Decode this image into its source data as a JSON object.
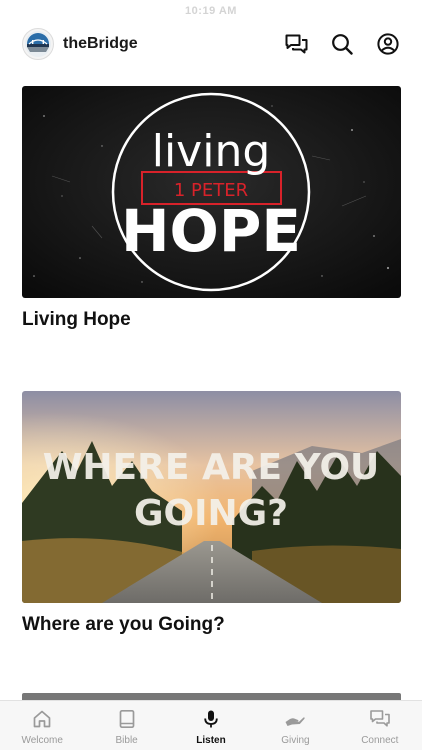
{
  "status_bar": {
    "time": "10:19 AM"
  },
  "header": {
    "app_name": "theBridge"
  },
  "feed": [
    {
      "title": "Living Hope",
      "artwork": {
        "line1": "living",
        "line2": "1 PETER",
        "line3": "HOPE"
      }
    },
    {
      "title": "Where are you Going?",
      "artwork": {
        "line1": "WHERE ARE YOU",
        "line2": "GOING?"
      }
    }
  ],
  "tabs": [
    {
      "label": "Welcome",
      "icon": "home-icon",
      "active": false
    },
    {
      "label": "Bible",
      "icon": "book-icon",
      "active": false
    },
    {
      "label": "Listen",
      "icon": "microphone-icon",
      "active": true
    },
    {
      "label": "Giving",
      "icon": "giving-hand-icon",
      "active": false
    },
    {
      "label": "Connect",
      "icon": "chat-bubbles-icon",
      "active": false
    }
  ],
  "colors": {
    "active_tab": "#111111",
    "inactive_tab": "#9a9a9a",
    "accent_red": "#d8222a",
    "tab_bar_bg": "#f7f7f7"
  }
}
